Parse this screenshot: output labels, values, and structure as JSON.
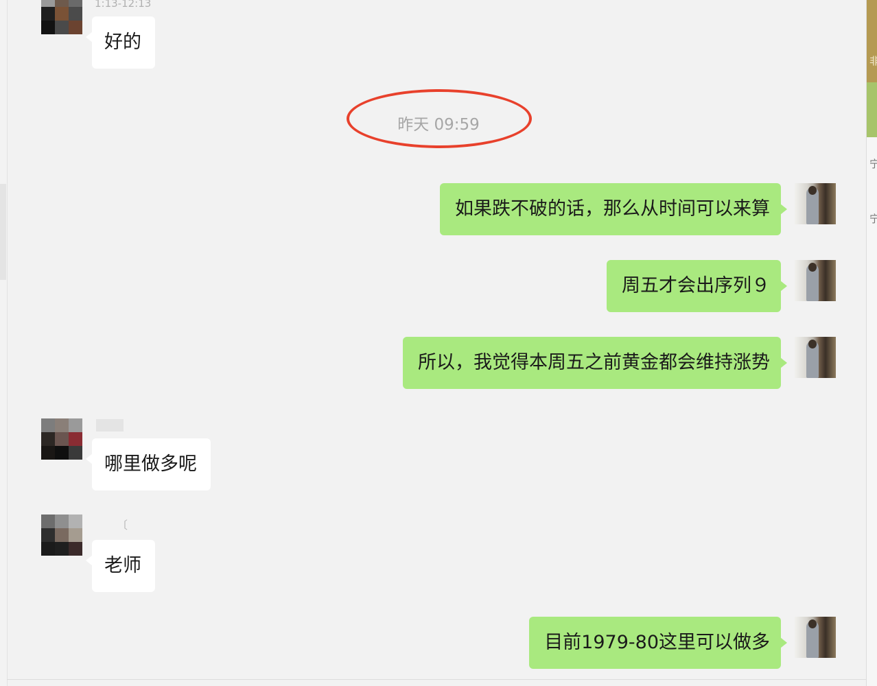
{
  "top_partial_text": "1:13-12:13",
  "timestamp": "昨天 09:59",
  "messages": {
    "m1": "好的",
    "m2": "如果跌不破的话，那么从时间可以来算",
    "m3": "周五才会出序列９",
    "m4": "所以，我觉得本周五之前黄金都会维持涨势",
    "m5": "哪里做多呢",
    "m6": "老师",
    "m7": "目前1979-80这里可以做多"
  },
  "sender_name_fragment": "〔",
  "right_panel_fragments": [
    "非",
    "宁",
    "宁"
  ],
  "colors": {
    "chat_background": "#f2f2f2",
    "incoming_bubble": "#ffffff",
    "outgoing_bubble": "#a9e97f",
    "timestamp_highlight": "#e8412c"
  },
  "icons": {
    "contact_avatar": "pixelated-avatar-icon",
    "own_avatar": "person-photo-avatar-icon"
  }
}
